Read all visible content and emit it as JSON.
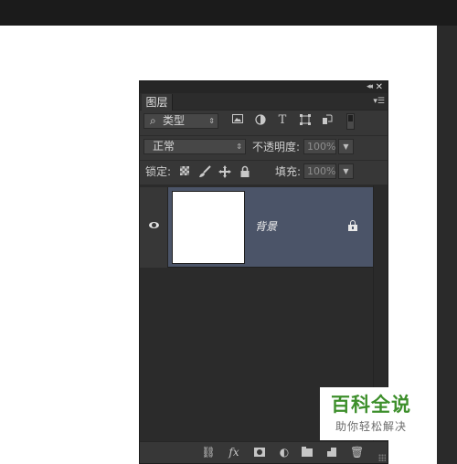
{
  "panel": {
    "collapse_glyph": "◂◂",
    "close_glyph": "✕",
    "tab_label": "图层",
    "menu_glyph": "▾☰"
  },
  "filter": {
    "kind_label": "类型",
    "search_glyph": "⌕",
    "dropdown_arrow": "⇕",
    "icons": [
      "image-filter-icon",
      "adjustment-filter-icon",
      "type-filter-icon",
      "shape-filter-icon",
      "smart-object-filter-icon"
    ],
    "type_glyph": "T"
  },
  "blend": {
    "mode": "正常",
    "dropdown_arrow": "⇕",
    "opacity_label": "不透明度:",
    "opacity_value": "100%"
  },
  "lock": {
    "label": "锁定:",
    "fill_label": "填充:",
    "fill_value": "100%"
  },
  "layers": [
    {
      "name": "背景",
      "visible": true,
      "locked": true
    }
  ],
  "bottom": {
    "link_glyph": "⛓",
    "fx_label": "fx",
    "adjust_glyph": "◐",
    "trash_glyph": "🗑"
  },
  "watermark": {
    "title": "百科全说",
    "subtitle": "助你轻松解决"
  },
  "colors": {
    "panel_bg": "#373737",
    "selected_layer": "#4b5468",
    "watermark_green": "#3d8f2b"
  }
}
